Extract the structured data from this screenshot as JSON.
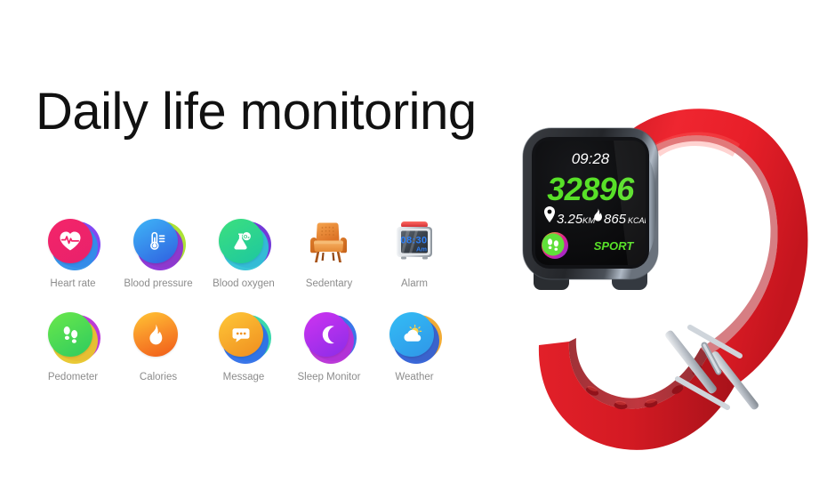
{
  "page": {
    "headline": "Daily life monitoring",
    "background_color": "#ffffff"
  },
  "features": {
    "row1": [
      {
        "id": "heart-rate",
        "label": "Heart rate",
        "icon": "heart-pulse-icon",
        "disc_from": "#f4246a",
        "disc_to": "#e8226b",
        "ring1": "#7b3ff2",
        "ring2": "#2f8fe8"
      },
      {
        "id": "blood-pressure",
        "label": "Blood pressure",
        "icon": "thermometer-icon",
        "disc_from": "#2fa9f2",
        "disc_to": "#2f6fe8",
        "ring1": "#a8e02a",
        "ring2": "#8b2fd6"
      },
      {
        "id": "blood-oxygen",
        "label": "Blood oxygen",
        "icon": "flask-o2-icon",
        "disc_from": "#2fd67a",
        "disc_to": "#21c98f",
        "ring1": "#6b2fd6",
        "ring2": "#2fc2d6"
      },
      {
        "id": "sedentary",
        "label": "Sedentary",
        "icon": "armchair-icon",
        "disc_from": "#f09030",
        "disc_to": "#e0752a",
        "ring1": "",
        "ring2": ""
      },
      {
        "id": "alarm",
        "label": "Alarm",
        "icon": "alarm-clock-icon",
        "disc_from": "#cfd3d8",
        "disc_to": "#9aa0a8",
        "ring1": "",
        "ring2": "",
        "clock_time": "08:30",
        "clock_meridiem": "Am"
      }
    ],
    "row2": [
      {
        "id": "pedometer",
        "label": "Pedometer",
        "icon": "footprints-icon",
        "disc_from": "#5ee04a",
        "disc_to": "#35cf5e",
        "ring1": "#b82fd6",
        "ring2": "#e8c62a"
      },
      {
        "id": "calories",
        "label": "Calories",
        "icon": "flame-icon",
        "disc_from": "#ffb328",
        "disc_to": "#f4661e",
        "ring1": "",
        "ring2": ""
      },
      {
        "id": "message",
        "label": "Message",
        "icon": "speech-bubble-icon",
        "disc_from": "#ffc233",
        "disc_to": "#f09022",
        "ring1": "#2fd6a8",
        "ring2": "#2f6fe8"
      },
      {
        "id": "sleep-monitor",
        "label": "Sleep Monitor",
        "icon": "crescent-moon-icon",
        "disc_from": "#c32df0",
        "disc_to": "#8f2fe8",
        "ring1": "#2f6fe8",
        "ring2": "#b82fd6"
      },
      {
        "id": "weather",
        "label": "Weather",
        "icon": "cloud-sun-icon",
        "disc_from": "#2fb8f0",
        "disc_to": "#2f9fe8",
        "ring1": "#f0a62a",
        "ring2": "#2f5fd6"
      }
    ]
  },
  "watch": {
    "strap_color": "#e51f29",
    "strap_shadow": "#b3161f",
    "case_color": "#2b2e33",
    "screen": {
      "time": "09:28",
      "steps": "32896",
      "distance_value": "3.25",
      "distance_unit": "KM",
      "calories_value": "865",
      "calories_unit": "KCAL",
      "mode_label": "SPORT",
      "accent_color": "#58e028",
      "time_color": "#ffffff",
      "background_color": "#0b0b0c",
      "distance_icon": "location-pin-icon",
      "calories_icon": "flame-icon",
      "badge_icon": "footprints-icon"
    }
  }
}
